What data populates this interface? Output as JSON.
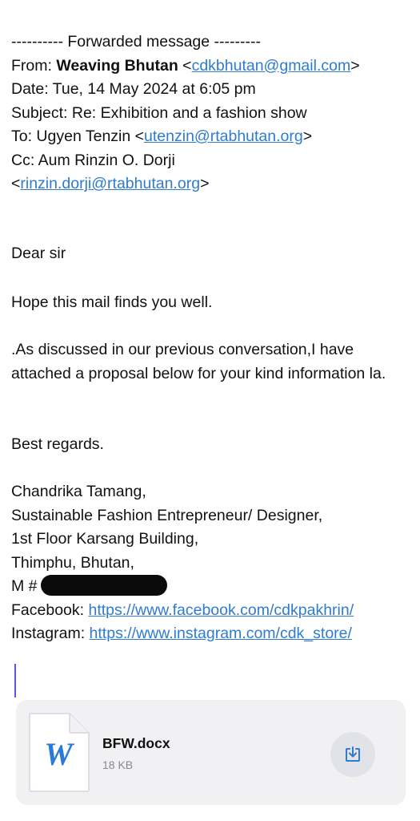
{
  "header": {
    "forward_line": "---------- Forwarded message ---------",
    "from_label": "From: ",
    "from_name": "Weaving Bhutan",
    "from_email": "cdkbhutan@gmail.com",
    "date_line": "Date: Tue, 14 May 2024 at 6:05 pm",
    "subject_line": "Subject: Re: Exhibition and a fashion show",
    "to_label": "To: Ugyen Tenzin <",
    "to_email": "utenzin@rtabhutan.org",
    "cc_line": "Cc: Aum Rinzin O. Dorji",
    "cc_email": "rinzin.dorji@rtabhutan.org"
  },
  "body": {
    "greeting": "Dear sir",
    "p1": "Hope this mail finds you well.",
    "p2": ".As discussed in our previous conversation,I have attached a proposal below for your kind information la.",
    "closing": "Best regards."
  },
  "signature": {
    "name": "Chandrika Tamang,",
    "title": "Sustainable Fashion Entrepreneur/ Designer,",
    "address1": "1st Floor Karsang Building,",
    "address2": "Thimphu, Bhutan,",
    "mobile_label": "M #",
    "facebook_label": "Facebook: ",
    "facebook_url": "https://www.facebook.com/cdkpakhrin/",
    "instagram_label": "Instagram: ",
    "instagram_url": "https://www.instagram.com/cdk_store/"
  },
  "attachment": {
    "icon": "word-document-icon",
    "icon_letter": "W",
    "filename": "BFW.docx",
    "size": "18 KB",
    "action_icon": "download-icon"
  },
  "colors": {
    "link": "#2f7ccf",
    "word_blue": "#2b7bd6",
    "cursor": "#5b56e8",
    "attachment_bg": "#f1f1f4"
  }
}
